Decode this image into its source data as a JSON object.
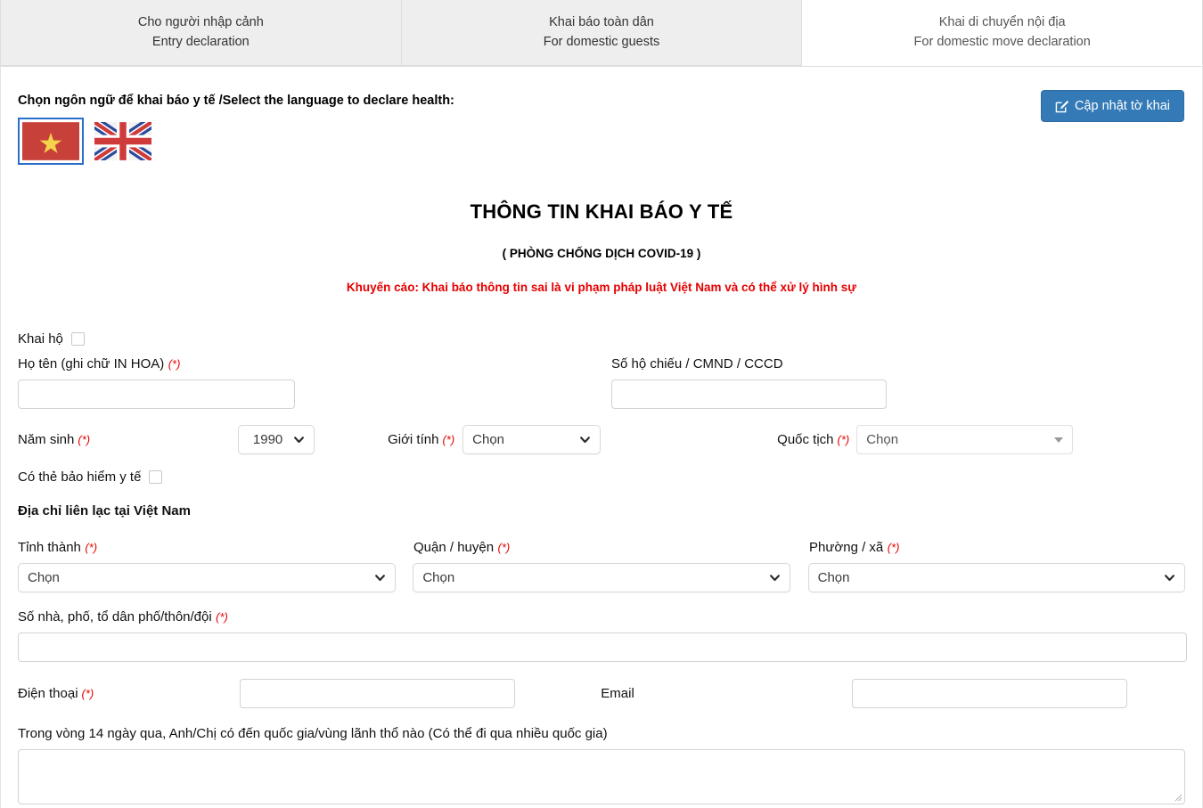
{
  "tabs": [
    {
      "line1": "Cho người nhập cảnh",
      "line2": "Entry declaration",
      "active": false
    },
    {
      "line1": "Khai báo toàn dân",
      "line2": "For domestic guests",
      "active": false
    },
    {
      "line1": "Khai di chuyển nội địa",
      "line2": "For domestic move declaration",
      "active": true
    }
  ],
  "language": {
    "label": "Chọn ngôn ngữ để khai báo y tế /Select the language to declare health:",
    "options": [
      {
        "name": "vietnam-flag",
        "selected": true
      },
      {
        "name": "uk-flag",
        "selected": false
      }
    ]
  },
  "update_button": {
    "label": "Cập nhật tờ khai",
    "icon": "edit-square-icon",
    "color": "#337ab7"
  },
  "titles": {
    "main": "THÔNG TIN KHAI BÁO Y TẾ",
    "sub": "( PHÒNG CHỐNG DỊCH COVID-19 )",
    "warning": "Khuyến cáo: Khai báo thông tin sai là vi phạm pháp luật Việt Nam và có thể xử lý hình sự",
    "warning_color": "#e60000"
  },
  "form": {
    "declare_for_other": {
      "label": "Khai hộ",
      "checked": false
    },
    "full_name": {
      "label": "Họ tên (ghi chữ IN HOA)",
      "required": "(*)",
      "value": "",
      "placeholder": ""
    },
    "passport": {
      "label": "Số hộ chiếu / CMND / CCCD",
      "required": "",
      "value": "",
      "placeholder": ""
    },
    "birth_year": {
      "label": "Năm sinh",
      "required": "(*)",
      "value": "1990"
    },
    "gender": {
      "label": "Giới tính",
      "required": "(*)",
      "value": "Chọn"
    },
    "nationality": {
      "label": "Quốc tịch",
      "required": "(*)",
      "value": "Chọn"
    },
    "has_insurance": {
      "label": "Có thẻ bảo hiểm y tế",
      "checked": false
    },
    "address_heading": "Địa chỉ liên lạc tại Việt Nam",
    "province": {
      "label": "Tỉnh thành",
      "required": "(*)",
      "value": "Chọn"
    },
    "district": {
      "label": "Quận / huyện",
      "required": "(*)",
      "value": "Chọn"
    },
    "ward": {
      "label": "Phường / xã",
      "required": "(*)",
      "value": "Chọn"
    },
    "street": {
      "label": "Số nhà, phố, tổ dân phố/thôn/đội",
      "required": "(*)",
      "value": "",
      "placeholder": ""
    },
    "phone": {
      "label": "Điện thoại",
      "required": "(*)",
      "value": "",
      "placeholder": ""
    },
    "email": {
      "label": "Email",
      "required": "",
      "value": "",
      "placeholder": ""
    },
    "travel_history": {
      "label": "Trong vòng 14 ngày qua, Anh/Chị có đến quốc gia/vùng lãnh thổ nào (Có thể đi qua nhiều quốc gia)",
      "value": "",
      "placeholder": ""
    }
  }
}
